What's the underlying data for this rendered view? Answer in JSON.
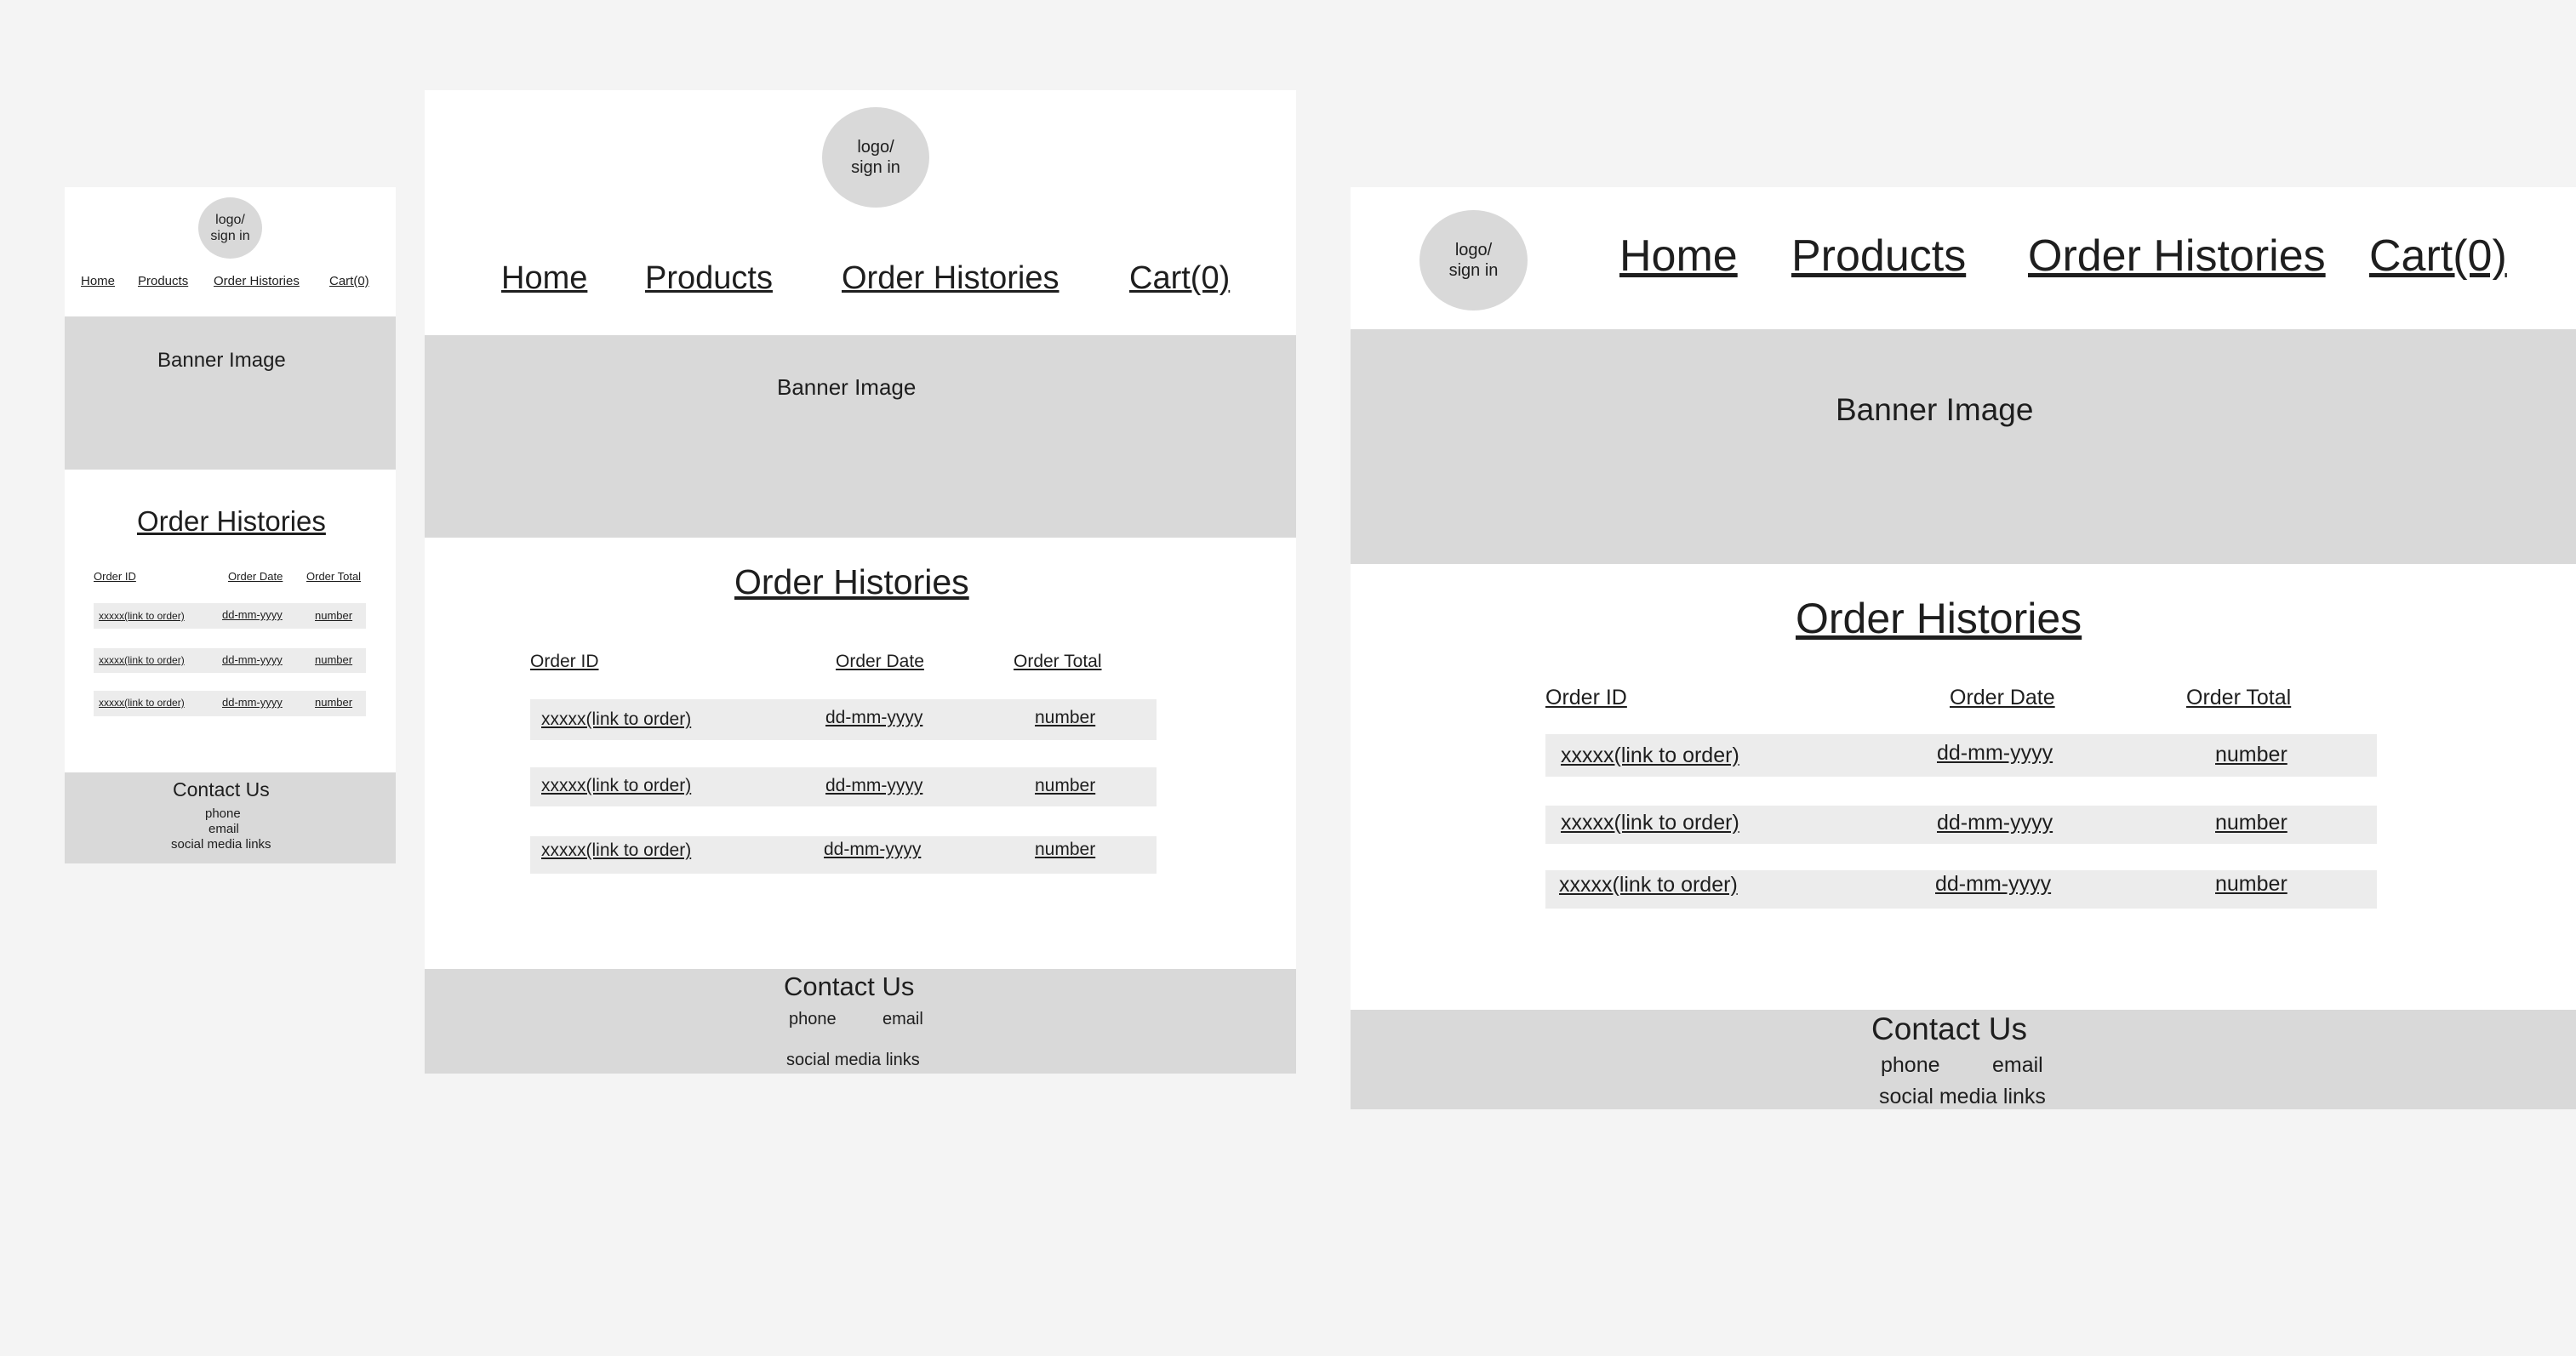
{
  "logo_label": [
    "logo/",
    "sign in"
  ],
  "nav": {
    "home": "Home",
    "products": "Products",
    "order_histories": "Order Histories",
    "cart": "Cart(0)"
  },
  "banner": "Banner Image",
  "page_title": "Order Histories",
  "table": {
    "headers": [
      "Order ID",
      "Order Date",
      "Order Total"
    ],
    "rows": [
      [
        "xxxxx(link to order)",
        "dd-mm-yyyy",
        "number"
      ],
      [
        "xxxxx(link to order)",
        "dd-mm-yyyy",
        "number"
      ],
      [
        "xxxxx(link to order)",
        "dd-mm-yyyy",
        "number"
      ]
    ]
  },
  "footer": {
    "title": "Contact Us",
    "phone": "phone",
    "email": "email",
    "social": "social media links"
  },
  "colors": {
    "canvas": "#f4f4f4",
    "frame": "#ffffff",
    "placeholder": "#d9d9d9",
    "row": "#ececec",
    "text": "#1e1e1e"
  }
}
